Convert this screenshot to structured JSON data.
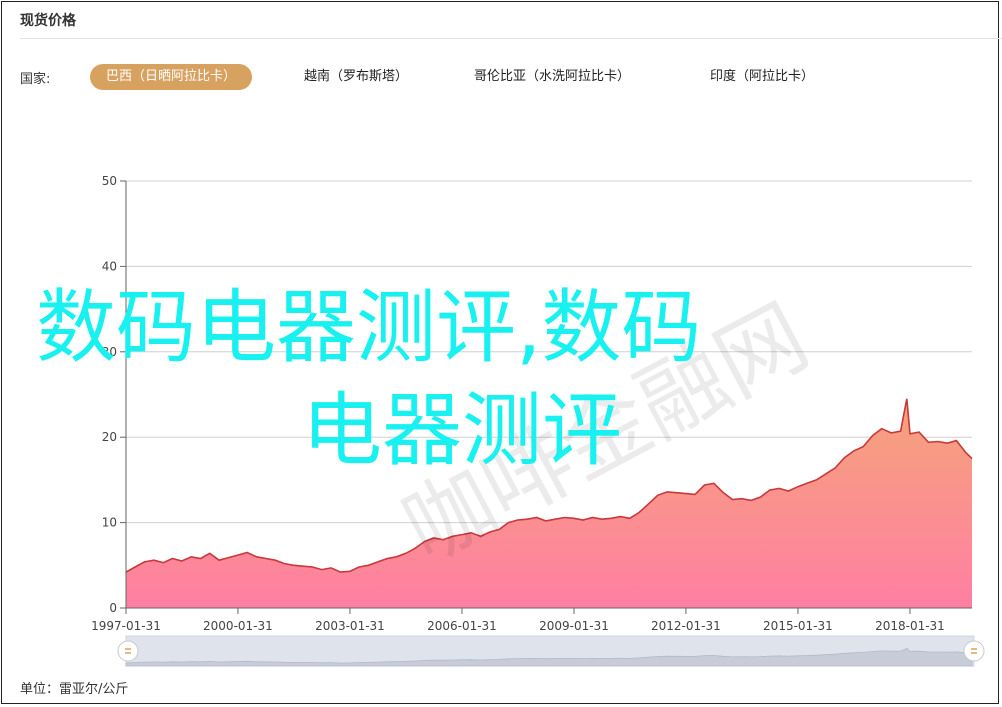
{
  "header": {
    "title": "现货价格"
  },
  "filters": {
    "label": "国家:",
    "tabs": [
      {
        "label": "巴西（日晒阿拉比卡）",
        "active": true
      },
      {
        "label": "越南（罗布斯塔）",
        "active": false
      },
      {
        "label": "哥伦比亚（水洗阿拉比卡）",
        "active": false
      },
      {
        "label": "印度（阿拉比卡）",
        "active": false
      }
    ]
  },
  "footer": {
    "unit": "单位：雷亚尔/公斤"
  },
  "overlay": {
    "line1": "数码电器测评,数码",
    "line2": "电器测评",
    "watermark": "咖啡金融网"
  },
  "colors": {
    "line": "#c9383a",
    "area_top": "#f5a37a",
    "area_bottom": "#ff7fa3",
    "active_tab": "#d7a260",
    "overlay_text": "#19f1f0"
  },
  "chart_data": {
    "type": "area",
    "x_ticks": [
      "1997-01-31",
      "2000-01-31",
      "2003-01-31",
      "2006-01-31",
      "2009-01-31",
      "2012-01-31",
      "2015-01-31",
      "2018-01-31"
    ],
    "y_ticks": [
      0,
      10,
      20,
      30,
      40,
      50
    ],
    "ylim": [
      0,
      50
    ],
    "xlim": [
      "1997-01-31",
      "2019-09-30"
    ],
    "grid": "horizontal",
    "series": [
      {
        "points": [
          [
            "1997-01-31",
            4.2
          ],
          [
            "1997-04-30",
            4.8
          ],
          [
            "1997-07-31",
            5.4
          ],
          [
            "1997-10-31",
            5.6
          ],
          [
            "1998-01-31",
            5.3
          ],
          [
            "1998-04-30",
            5.8
          ],
          [
            "1998-07-31",
            5.5
          ],
          [
            "1998-10-31",
            6.0
          ],
          [
            "1999-01-31",
            5.8
          ],
          [
            "1999-04-30",
            6.4
          ],
          [
            "1999-07-31",
            5.6
          ],
          [
            "1999-10-31",
            5.9
          ],
          [
            "2000-01-31",
            6.2
          ],
          [
            "2000-04-30",
            6.5
          ],
          [
            "2000-07-31",
            6.0
          ],
          [
            "2000-10-31",
            5.8
          ],
          [
            "2001-01-31",
            5.6
          ],
          [
            "2001-04-30",
            5.2
          ],
          [
            "2001-07-31",
            5.0
          ],
          [
            "2001-10-31",
            4.9
          ],
          [
            "2002-01-31",
            4.8
          ],
          [
            "2002-04-30",
            4.5
          ],
          [
            "2002-07-31",
            4.7
          ],
          [
            "2002-10-31",
            4.2
          ],
          [
            "2003-01-31",
            4.3
          ],
          [
            "2003-04-30",
            4.8
          ],
          [
            "2003-07-31",
            5.0
          ],
          [
            "2003-10-31",
            5.4
          ],
          [
            "2004-01-31",
            5.8
          ],
          [
            "2004-04-30",
            6.0
          ],
          [
            "2004-07-31",
            6.4
          ],
          [
            "2004-10-31",
            7.0
          ],
          [
            "2005-01-31",
            7.8
          ],
          [
            "2005-04-30",
            8.2
          ],
          [
            "2005-07-31",
            8.0
          ],
          [
            "2005-10-31",
            8.4
          ],
          [
            "2006-01-31",
            8.6
          ],
          [
            "2006-04-30",
            8.8
          ],
          [
            "2006-07-31",
            8.4
          ],
          [
            "2006-10-31",
            8.9
          ],
          [
            "2007-01-31",
            9.2
          ],
          [
            "2007-04-30",
            10.0
          ],
          [
            "2007-07-31",
            10.3
          ],
          [
            "2007-10-31",
            10.4
          ],
          [
            "2008-01-31",
            10.6
          ],
          [
            "2008-04-30",
            10.2
          ],
          [
            "2008-07-31",
            10.4
          ],
          [
            "2008-10-31",
            10.6
          ],
          [
            "2009-01-31",
            10.5
          ],
          [
            "2009-04-30",
            10.3
          ],
          [
            "2009-07-31",
            10.6
          ],
          [
            "2009-10-31",
            10.4
          ],
          [
            "2010-01-31",
            10.5
          ],
          [
            "2010-04-30",
            10.7
          ],
          [
            "2010-07-31",
            10.5
          ],
          [
            "2010-10-31",
            11.2
          ],
          [
            "2011-01-31",
            12.2
          ],
          [
            "2011-04-30",
            13.2
          ],
          [
            "2011-07-31",
            13.6
          ],
          [
            "2011-10-31",
            13.5
          ],
          [
            "2012-01-31",
            13.4
          ],
          [
            "2012-04-30",
            13.3
          ],
          [
            "2012-07-31",
            14.4
          ],
          [
            "2012-10-31",
            14.6
          ],
          [
            "2013-01-31",
            13.5
          ],
          [
            "2013-04-30",
            12.7
          ],
          [
            "2013-07-31",
            12.8
          ],
          [
            "2013-10-31",
            12.6
          ],
          [
            "2014-01-31",
            13.0
          ],
          [
            "2014-04-30",
            13.8
          ],
          [
            "2014-07-31",
            14.0
          ],
          [
            "2014-10-31",
            13.7
          ],
          [
            "2015-01-31",
            14.2
          ],
          [
            "2015-04-30",
            14.6
          ],
          [
            "2015-07-31",
            15.0
          ],
          [
            "2015-10-31",
            15.7
          ],
          [
            "2016-01-31",
            16.4
          ],
          [
            "2016-04-30",
            17.6
          ],
          [
            "2016-07-31",
            18.4
          ],
          [
            "2016-10-31",
            18.9
          ],
          [
            "2017-01-31",
            20.2
          ],
          [
            "2017-04-30",
            21.0
          ],
          [
            "2017-07-31",
            20.5
          ],
          [
            "2017-10-31",
            20.7
          ],
          [
            "2017-12-31",
            24.5
          ],
          [
            "2018-01-31",
            20.4
          ],
          [
            "2018-04-30",
            20.6
          ],
          [
            "2018-07-31",
            19.4
          ],
          [
            "2018-10-31",
            19.5
          ],
          [
            "2019-01-31",
            19.3
          ],
          [
            "2019-04-30",
            19.6
          ],
          [
            "2019-07-31",
            18.2
          ],
          [
            "2019-09-30",
            17.5
          ]
        ]
      }
    ]
  }
}
